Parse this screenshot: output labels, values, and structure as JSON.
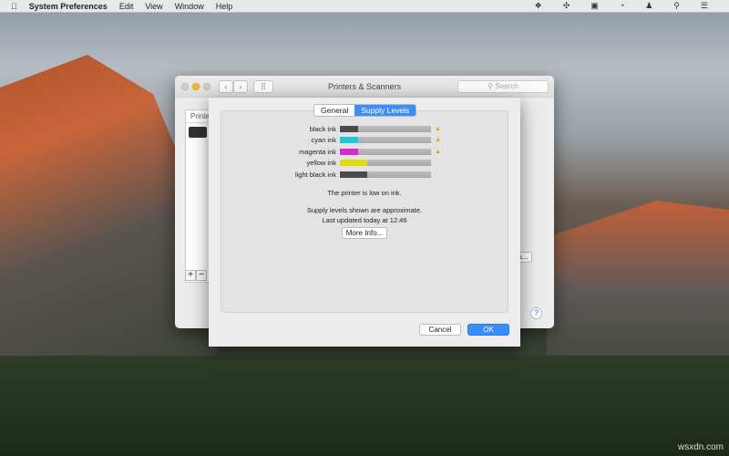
{
  "menubar": {
    "app": "System Preferences",
    "items": [
      "Edit",
      "View",
      "Window",
      "Help"
    ],
    "tray": [
      "dropbox-icon",
      "vpn-icon",
      "display-icon",
      "wifi-icon",
      "user-icon",
      "spotlight-icon",
      "notifications-icon"
    ]
  },
  "window": {
    "title": "Printers & Scanners",
    "search_placeholder": "Search",
    "printers_header": "Printe",
    "add": "+",
    "remove": "−",
    "side_button": "s...",
    "help": "?",
    "back": "‹",
    "forward": "›"
  },
  "sheet": {
    "tabs": [
      {
        "label": "General",
        "active": false
      },
      {
        "label": "Supply Levels",
        "active": true
      }
    ],
    "supplies": [
      {
        "label": "black ink",
        "level": 0.2,
        "color": "#4a4a4a",
        "low": true
      },
      {
        "label": "cyan ink",
        "level": 0.2,
        "color": "#1ec8d4",
        "low": true
      },
      {
        "label": "magenta ink",
        "level": 0.2,
        "color": "#d42ad0",
        "low": true
      },
      {
        "label": "yellow ink",
        "level": 0.3,
        "color": "#e0dc10",
        "low": false
      },
      {
        "label": "light black ink",
        "level": 0.3,
        "color": "#4a4a4a",
        "low": false
      }
    ],
    "warning_glyph": "▲",
    "status": "The printer is low on ink.",
    "note": "Supply levels shown are approximate.",
    "updated": "Last updated today at 12:46",
    "more_info": "More Info...",
    "cancel": "Cancel",
    "ok": "OK"
  },
  "watermark": "wsxdn.com"
}
